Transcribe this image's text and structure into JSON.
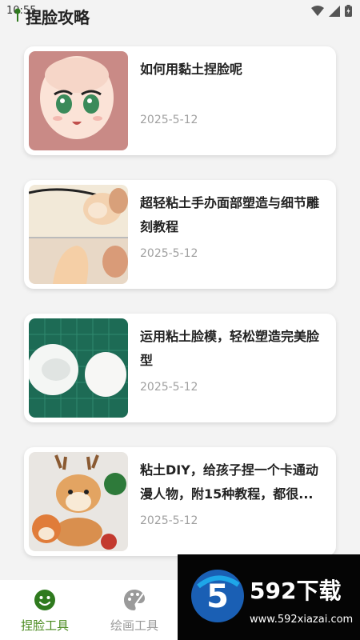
{
  "status_bar": {
    "time": "10:55"
  },
  "header": {
    "title": "捏脸攻略"
  },
  "articles": [
    {
      "title": "如何用黏土捏脸呢",
      "date": "2025-5-12"
    },
    {
      "title": "超轻粘土手办面部塑造与细节雕刻教程",
      "date": "2025-5-12"
    },
    {
      "title": "运用粘土脸模，轻松塑造完美脸型",
      "date": "2025-5-12"
    },
    {
      "title": "粘土DIY，给孩子捏一个卡通动漫人物，附15种教程，都很...",
      "date": "2025-5-12"
    }
  ],
  "bottom_nav": {
    "items": [
      {
        "label": "捏脸工具",
        "icon": "smiley-icon",
        "active": true
      },
      {
        "label": "绘画工具",
        "icon": "palette-icon",
        "active": false
      }
    ]
  },
  "watermark": {
    "brand": "592下载",
    "url": "www.592xiazai.com",
    "logo_text": "5"
  },
  "colors": {
    "accent": "#4a8a1f",
    "inactive": "#9a9a9a",
    "date": "#a0a0a0",
    "background": "#f3f3f3"
  }
}
